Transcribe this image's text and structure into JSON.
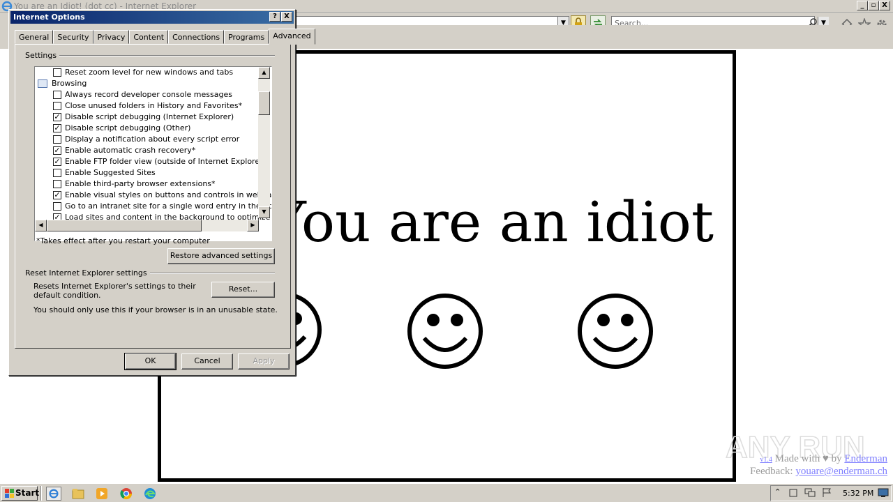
{
  "browser": {
    "window_title": "You are an Idiot! (dot cc) - Internet Explorer",
    "search_placeholder": "Search...",
    "window_controls": [
      "_",
      "▫",
      "X"
    ]
  },
  "page": {
    "headline": "You are an idiot",
    "credit": {
      "version": "v1.4",
      "made_with": "Made with",
      "by": "by",
      "author": "Enderman",
      "feedback_label": "Feedback:",
      "feedback_email": "youare@enderman.ch"
    },
    "watermark": "ANY RUN"
  },
  "dialog": {
    "title": "Internet Options",
    "help_label": "?",
    "close_label": "X",
    "tabs": [
      "General",
      "Security",
      "Privacy",
      "Content",
      "Connections",
      "Programs",
      "Advanced"
    ],
    "active_tab": "Advanced",
    "settings_group": "Settings",
    "settings": [
      {
        "label": "Reset zoom level for new windows and tabs",
        "checked": false,
        "type": "checkbox"
      },
      {
        "label": "Browsing",
        "type": "category"
      },
      {
        "label": "Always record developer console messages",
        "checked": false,
        "type": "checkbox"
      },
      {
        "label": "Close unused folders in History and Favorites*",
        "checked": false,
        "type": "checkbox"
      },
      {
        "label": "Disable script debugging (Internet Explorer)",
        "checked": true,
        "type": "checkbox"
      },
      {
        "label": "Disable script debugging (Other)",
        "checked": true,
        "type": "checkbox"
      },
      {
        "label": "Display a notification about every script error",
        "checked": false,
        "type": "checkbox"
      },
      {
        "label": "Enable automatic crash recovery*",
        "checked": true,
        "type": "checkbox"
      },
      {
        "label": "Enable FTP folder view (outside of Internet Explorer)",
        "checked": true,
        "type": "checkbox"
      },
      {
        "label": "Enable Suggested Sites",
        "checked": false,
        "type": "checkbox"
      },
      {
        "label": "Enable third-party browser extensions*",
        "checked": false,
        "type": "checkbox"
      },
      {
        "label": "Enable visual styles on buttons and controls in webpages",
        "checked": true,
        "type": "checkbox"
      },
      {
        "label": "Go to an intranet site for a single word entry in the Address bar",
        "checked": false,
        "type": "checkbox"
      },
      {
        "label": "Load sites and content in the background to optimize performance",
        "checked": true,
        "type": "checkbox"
      }
    ],
    "restart_note": "*Takes effect after you restart your computer",
    "restore_button": "Restore advanced settings",
    "reset_group": "Reset Internet Explorer settings",
    "reset_description": "Resets Internet Explorer's settings to their default condition.",
    "reset_button": "Reset...",
    "reset_warning": "You should only use this if your browser is in an unusable state.",
    "ok_button": "OK",
    "cancel_button": "Cancel",
    "apply_button": "Apply"
  },
  "taskbar": {
    "start_label": "Start",
    "clock": "5:32 PM"
  }
}
